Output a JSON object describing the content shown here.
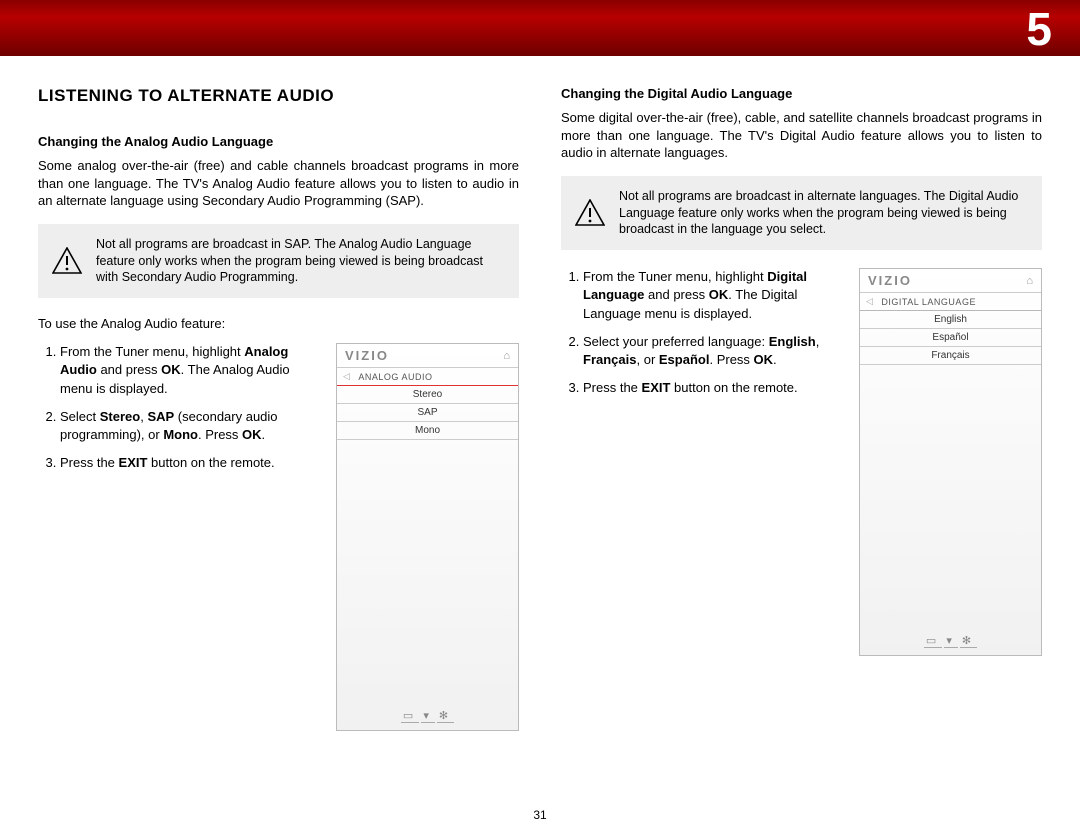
{
  "chapter_number": "5",
  "page_number": "31",
  "left": {
    "section_title": "LISTENING TO ALTERNATE AUDIO",
    "sub_title": "Changing the Analog Audio Language",
    "intro": "Some analog over-the-air (free) and cable channels broadcast programs in more than one language. The TV's Analog Audio feature allows you to listen to audio in an alternate language using Secondary Audio Programming (SAP).",
    "note": "Not all programs are broadcast in SAP. The Analog Audio Language feature only works when the program being viewed is being broadcast with Secondary Audio Programming.",
    "lead_in": "To use the Analog Audio feature:",
    "steps": {
      "s1a": "From the Tuner menu, highlight ",
      "s1b": "Analog Audio",
      "s1c": " and press ",
      "s1d": "OK",
      "s1e": ". The Analog Audio menu is displayed.",
      "s2a": "Select ",
      "s2b": "Stereo",
      "s2c": ", ",
      "s2d": "SAP",
      "s2e": " (secondary audio programming), or ",
      "s2f": "Mono",
      "s2g": ". Press ",
      "s2h": "OK",
      "s2i": ".",
      "s3a": "Press the ",
      "s3b": "EXIT",
      "s3c": " button on the remote."
    },
    "menu": {
      "brand": "VIZIO",
      "crumb": "ANALOG AUDIO",
      "items": [
        "Stereo",
        "SAP",
        "Mono"
      ]
    }
  },
  "right": {
    "sub_title": "Changing the Digital Audio Language",
    "intro": "Some digital over-the-air (free), cable, and satellite channels broadcast programs in more than one language. The TV's Digital Audio feature allows you to listen to audio in alternate languages.",
    "note": "Not all programs are broadcast in alternate languages. The Digital Audio Language feature only works when the program being viewed is being broadcast in the language you select.",
    "steps": {
      "s1a": "From the Tuner menu, highlight ",
      "s1b": "Digital Language",
      "s1c": " and press ",
      "s1d": "OK",
      "s1e": ". The Digital Language menu is displayed.",
      "s2a": "Select your preferred language: ",
      "s2b": "English",
      "s2c": ", ",
      "s2d": "Français",
      "s2e": ", or ",
      "s2f": "Español",
      "s2g": ". Press ",
      "s2h": "OK",
      "s2i": ".",
      "s3a": "Press the ",
      "s3b": "EXIT",
      "s3c": " button on the remote."
    },
    "menu": {
      "brand": "VIZIO",
      "crumb": "DIGITAL LANGUAGE",
      "items": [
        "English",
        "Español",
        "Français"
      ]
    }
  }
}
